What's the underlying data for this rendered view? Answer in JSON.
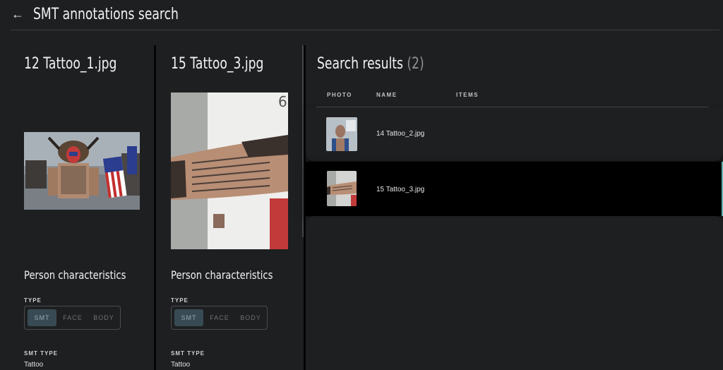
{
  "header": {
    "title": "SMT annotations search",
    "back_icon": "arrow-left-icon"
  },
  "columns": [
    {
      "image_title": "12 Tattoo_1.jpg",
      "section_title": "Person characteristics",
      "type_label": "TYPE",
      "type_options": [
        "SMT",
        "FACE",
        "BODY"
      ],
      "type_selected": "SMT",
      "smt_type_label": "SMT TYPE",
      "smt_type_value": "Tattoo"
    },
    {
      "image_title": "15 Tattoo_3.jpg",
      "section_title": "Person characteristics",
      "type_label": "TYPE",
      "type_options": [
        "SMT",
        "FACE",
        "BODY"
      ],
      "type_selected": "SMT",
      "smt_type_label": "SMT TYPE",
      "smt_type_value": "Tattoo"
    }
  ],
  "results": {
    "title": "Search results",
    "count": "(2)",
    "columns": [
      "PHOTO",
      "NAME",
      "ITEMS"
    ],
    "rows": [
      {
        "name": "14 Tattoo_2.jpg",
        "selected": false
      },
      {
        "name": "15 Tattoo_3.jpg",
        "selected": true
      }
    ]
  },
  "colors": {
    "background": "#1e1f21",
    "selected_row": "#000000",
    "segment_active": "#384b55",
    "accent": "#5fb7b4"
  }
}
